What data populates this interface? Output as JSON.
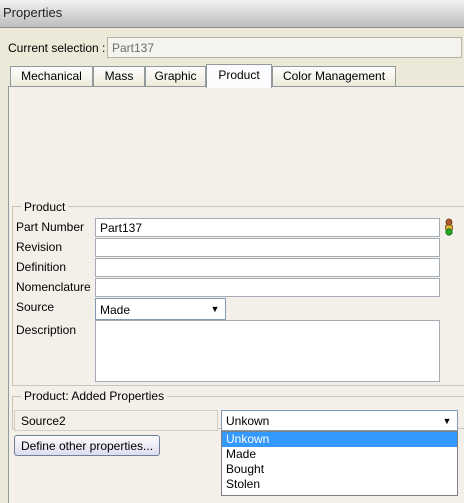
{
  "window": {
    "title": "Properties"
  },
  "current_selection": {
    "label": "Current selection :",
    "value": "Part137"
  },
  "tabs": [
    {
      "label": "Mechanical",
      "active": false
    },
    {
      "label": "Mass",
      "active": false
    },
    {
      "label": "Graphic",
      "active": false
    },
    {
      "label": "Product",
      "active": true
    },
    {
      "label": "Color Management",
      "active": false
    }
  ],
  "product": {
    "legend": "Product",
    "part_number": {
      "label": "Part Number",
      "value": "Part137"
    },
    "revision": {
      "label": "Revision",
      "value": ""
    },
    "definition": {
      "label": "Definition",
      "value": ""
    },
    "nomenclature": {
      "label": "Nomenclature",
      "value": ""
    },
    "source": {
      "label": "Source",
      "value": "Made"
    },
    "description": {
      "label": "Description",
      "value": ""
    },
    "part_status_icon": "person-status-icon"
  },
  "added_properties": {
    "legend": "Product: Added Properties",
    "source2": {
      "label": "Source2",
      "value": "Unkown"
    },
    "define_button": "Define other properties...",
    "options": [
      "Unkown",
      "Made",
      "Bought",
      "Stolen"
    ],
    "selected_index": 0
  },
  "colors": {
    "selection": "#3399ff",
    "background": "#ece9d8",
    "field_border": "#7f9db9"
  }
}
